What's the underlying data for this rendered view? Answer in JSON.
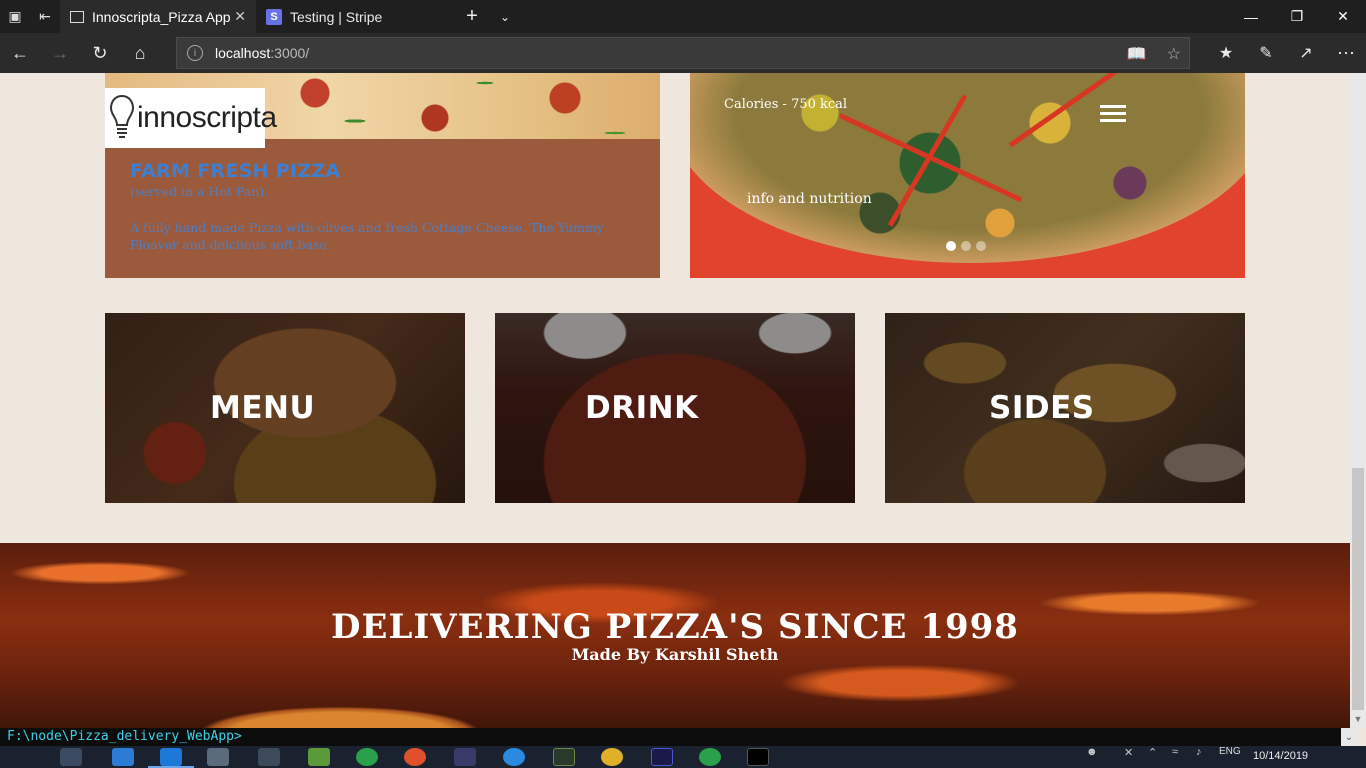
{
  "browser": {
    "tabs": [
      {
        "title": "Innoscripta_Pizza App",
        "favicon": "page-icon",
        "active": true
      },
      {
        "title": "Testing | Stripe",
        "favicon": "S",
        "active": false
      }
    ],
    "url_host": "localhost",
    "url_path": ":3000/"
  },
  "feature": {
    "logo_text": "innoscripta",
    "title": "FARM FRESH PIZZA",
    "subtitle": "(served in a Hot Pan).",
    "description": "A fully hand made Pizza with olives and fresh Cottage Cheese. The Yummy Floavor and delciious soft base."
  },
  "slider": {
    "calories": "Calories - 750 kcal",
    "info_link": "info and nutrition",
    "slide_count": 3,
    "active_slide": 1
  },
  "categories": [
    {
      "label": "MENU"
    },
    {
      "label": "DRINK"
    },
    {
      "label": "SIDES"
    }
  ],
  "banner": {
    "title": "DELIVERING PIZZA'S SINCE 1998",
    "subtitle": "Made By Karshil Sheth"
  },
  "terminal": {
    "prompt": "F:\\node\\Pizza_delivery_WebApp>"
  },
  "taskbar": {
    "language": "ENG",
    "date": "10/14/2019"
  },
  "colors": {
    "page_bg": "#efe7dd",
    "feature_bg": "#9c5a3c",
    "feature_title": "#3d7fd0",
    "slider_bg": "#e2432d",
    "terminal_text": "#3fd0e8"
  }
}
